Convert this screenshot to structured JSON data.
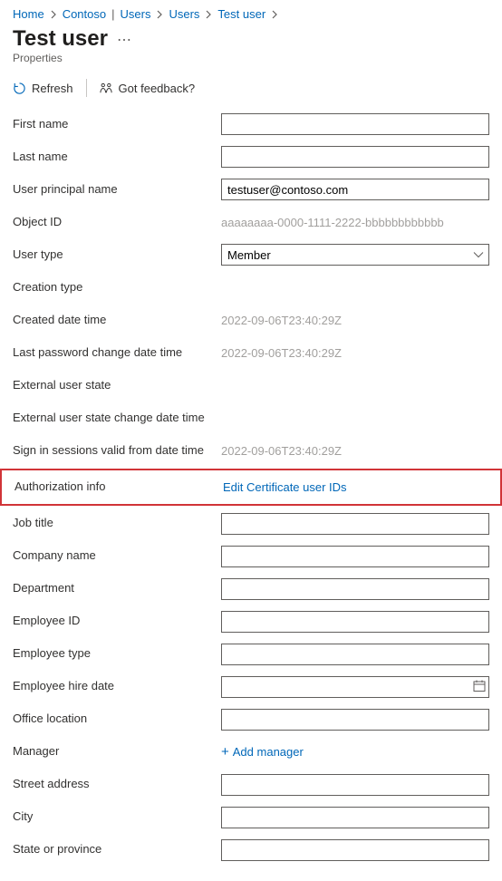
{
  "breadcrumb": {
    "home": "Home",
    "org": "Contoso",
    "path1": "Users",
    "path2": "Users",
    "path3": "Test user"
  },
  "header": {
    "title": "Test user",
    "subtitle": "Properties"
  },
  "toolbar": {
    "refresh_label": "Refresh",
    "feedback_label": "Got feedback?"
  },
  "fields": {
    "first_name": {
      "label": "First name",
      "value": ""
    },
    "last_name": {
      "label": "Last name",
      "value": ""
    },
    "upn": {
      "label": "User principal name",
      "value": "testuser@contoso.com"
    },
    "object_id": {
      "label": "Object ID",
      "value": "aaaaaaaa-0000-1111-2222-bbbbbbbbbbbb"
    },
    "user_type": {
      "label": "User type",
      "value": "Member"
    },
    "creation_type": {
      "label": "Creation type",
      "value": ""
    },
    "created": {
      "label": "Created date time",
      "value": "2022-09-06T23:40:29Z"
    },
    "last_pw_change": {
      "label": "Last password change date time",
      "value": "2022-09-06T23:40:29Z"
    },
    "ext_user_state": {
      "label": "External user state",
      "value": ""
    },
    "ext_user_state_change": {
      "label": "External user state change date time",
      "value": ""
    },
    "signin_valid": {
      "label": "Sign in sessions valid from date time",
      "value": "2022-09-06T23:40:29Z"
    },
    "auth_info": {
      "label": "Authorization info",
      "link": "Edit Certificate user IDs"
    },
    "job_title": {
      "label": "Job title",
      "value": ""
    },
    "company_name": {
      "label": "Company name",
      "value": ""
    },
    "department": {
      "label": "Department",
      "value": ""
    },
    "employee_id": {
      "label": "Employee ID",
      "value": ""
    },
    "employee_type": {
      "label": "Employee type",
      "value": ""
    },
    "employee_hire_date": {
      "label": "Employee hire date",
      "value": ""
    },
    "office_location": {
      "label": "Office location",
      "value": ""
    },
    "manager": {
      "label": "Manager",
      "link": "Add manager"
    },
    "street_address": {
      "label": "Street address",
      "value": ""
    },
    "city": {
      "label": "City",
      "value": ""
    },
    "state_province": {
      "label": "State or province",
      "value": ""
    }
  }
}
